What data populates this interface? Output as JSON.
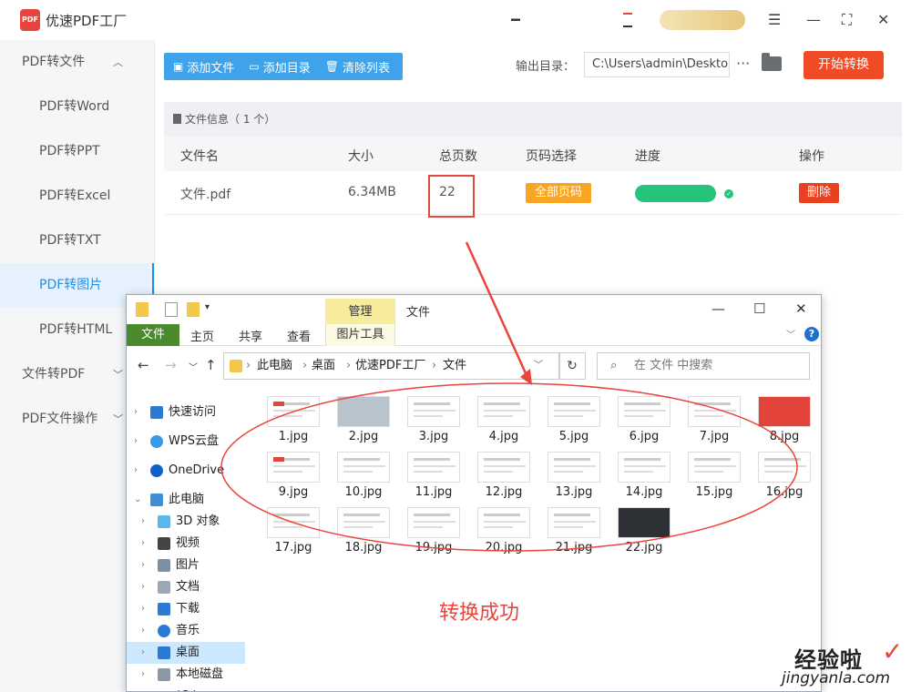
{
  "app": {
    "title": "优速PDF工厂",
    "logo_text": "PDF"
  },
  "sidebar": {
    "items": [
      {
        "label": "PDF转文件",
        "kind": "top",
        "chevron": "^"
      },
      {
        "label": "PDF转Word",
        "kind": "sub"
      },
      {
        "label": "PDF转PPT",
        "kind": "sub"
      },
      {
        "label": "PDF转Excel",
        "kind": "sub"
      },
      {
        "label": "PDF转TXT",
        "kind": "sub"
      },
      {
        "label": "PDF转图片",
        "kind": "sub",
        "active": true
      },
      {
        "label": "PDF转HTML",
        "kind": "sub"
      },
      {
        "label": "文件转PDF",
        "kind": "top",
        "chevron": "v"
      },
      {
        "label": "PDF文件操作",
        "kind": "top",
        "chevron": "v"
      }
    ]
  },
  "toolbar": {
    "add_file": "添加文件",
    "add_dir": "添加目录",
    "clear_list": "清除列表",
    "output_label": "输出目录：",
    "output_path": "C:\\Users\\admin\\Deskto",
    "more": "···",
    "start": "开始转换"
  },
  "file_panel": {
    "label": "文件信息（ 1 个）"
  },
  "table": {
    "headers": [
      "文件名",
      "大小",
      "总页数",
      "页码选择",
      "进度",
      "操作"
    ],
    "row": {
      "name": "文件.pdf",
      "size": "6.34MB",
      "pages": "22",
      "page_select": "全部页码",
      "progress": 1.0,
      "action": "删除"
    }
  },
  "explorer": {
    "title": "文件",
    "ribbon_context": "管理",
    "tabs": [
      "文件",
      "主页",
      "共享",
      "查看"
    ],
    "context_tab": "图片工具",
    "breadcrumb": [
      "此电脑",
      "桌面",
      "优速PDF工厂",
      "文件"
    ],
    "search_placeholder": "在 文件 中搜索",
    "nav": [
      {
        "label": "快速访问",
        "icon": "star-icon"
      },
      {
        "label": "WPS云盘",
        "icon": "cloud-icon"
      },
      {
        "label": "OneDrive",
        "icon": "cloud-icon"
      },
      {
        "label": "此电脑",
        "icon": "computer-icon"
      },
      {
        "label": "3D 对象",
        "icon": "cube-icon"
      },
      {
        "label": "视频",
        "icon": "video-icon"
      },
      {
        "label": "图片",
        "icon": "picture-icon"
      },
      {
        "label": "文档",
        "icon": "document-icon"
      },
      {
        "label": "下载",
        "icon": "download-icon"
      },
      {
        "label": "音乐",
        "icon": "music-icon"
      },
      {
        "label": "桌面",
        "icon": "desktop-icon",
        "selected": true
      },
      {
        "label": "本地磁盘 (C:)",
        "icon": "disk-icon"
      }
    ],
    "files": [
      "1.jpg",
      "2.jpg",
      "3.jpg",
      "4.jpg",
      "5.jpg",
      "6.jpg",
      "7.jpg",
      "8.jpg",
      "9.jpg",
      "10.jpg",
      "11.jpg",
      "12.jpg",
      "13.jpg",
      "14.jpg",
      "15.jpg",
      "16.jpg",
      "17.jpg",
      "18.jpg",
      "19.jpg",
      "20.jpg",
      "21.jpg",
      "22.jpg"
    ]
  },
  "annotation": {
    "success": "转换成功"
  },
  "watermark": {
    "cn": "经验啦",
    "url": "jingyanla.com"
  },
  "colors": {
    "accent_blue": "#3ea3ea",
    "start_orange": "#f04a26",
    "annotation_red": "#e8453c",
    "progress_green": "#26c47a"
  }
}
